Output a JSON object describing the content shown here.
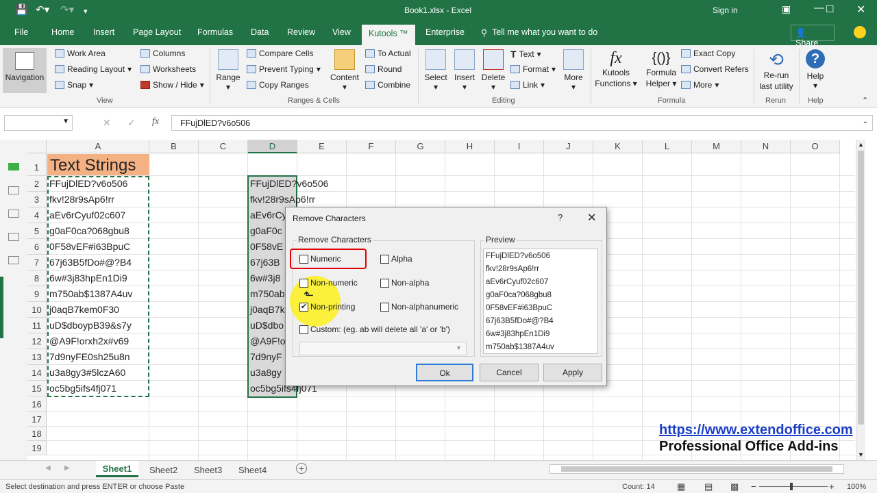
{
  "window": {
    "title": "Book1.xlsx  -  Excel",
    "sign_in": "Sign in"
  },
  "tabs": [
    "File",
    "Home",
    "Insert",
    "Page Layout",
    "Formulas",
    "Data",
    "Review",
    "View",
    "Kutools ™",
    "Enterprise"
  ],
  "tell_me": "Tell me what you want to do",
  "share": "Share",
  "ribbon": {
    "view_group": {
      "navigation": "Navigation",
      "work_area": "Work Area",
      "reading_layout": "Reading Layout",
      "snap": "Snap",
      "columns": "Columns",
      "worksheets": "Worksheets",
      "show_hide": "Show / Hide",
      "label": "View"
    },
    "ranges_group": {
      "range": "Range",
      "compare_cells": "Compare Cells",
      "prevent_typing": "Prevent Typing",
      "copy_ranges": "Copy Ranges",
      "content": "Content",
      "to_actual": "To Actual",
      "round": "Round",
      "combine": "Combine",
      "label": "Ranges & Cells"
    },
    "editing_group": {
      "select": "Select",
      "insert": "Insert",
      "delete": "Delete",
      "text": "Text",
      "format": "Format",
      "link": "Link",
      "more": "More",
      "label": "Editing"
    },
    "formula_group": {
      "kutools_functions": "Kutools\nFunctions",
      "formula_helper": "Formula\nHelper",
      "exact_copy": "Exact Copy",
      "convert_refers": "Convert Refers",
      "more": "More",
      "label": "Formula"
    },
    "rerun_group": {
      "rerun": "Re-run\nlast utility",
      "label": "Rerun"
    },
    "help_group": {
      "help": "Help",
      "label": "Help"
    }
  },
  "formula_bar": {
    "name_box": "",
    "content": "FFujDlED?v6o506",
    "fx": "fx"
  },
  "columns": [
    "A",
    "B",
    "C",
    "D",
    "E",
    "F",
    "G",
    "H",
    "I",
    "J",
    "K",
    "L",
    "M",
    "N",
    "O"
  ],
  "rows": [
    "1",
    "2",
    "3",
    "4",
    "5",
    "6",
    "7",
    "8",
    "9",
    "10",
    "11",
    "12",
    "13",
    "14",
    "15",
    "16",
    "17",
    "18",
    "19"
  ],
  "header_cell": "Text Strings",
  "col_a": [
    "FFujDlED?v6o506",
    "fkv!28r9sAp6!rr",
    "aEv6rCyuf02c607",
    "g0aF0ca?068gbu8",
    "0F58vEF#i63BpuC",
    "67j63B5fDo#@?B4",
    "6w#3j83hpEn1Di9",
    "m750ab$1387A4uv",
    "j0aqB7kem0F30",
    "uD$dboypB39&s7y",
    "@A9F!orxh2x#v69",
    "7d9nyFE0sh25u8n",
    "u3a8gy3#5lczA60",
    "oc5bg5ifs4fj071"
  ],
  "col_d": [
    "FFujDlED?v6o506",
    "fkv!28r9sAp6!rr",
    "aEv6rCy",
    "g0aF0c",
    "0F58vE",
    "67j63B",
    "6w#3j8",
    "m750ab",
    "j0aqB7k",
    "uD$dbo",
    "@A9F!o",
    "7d9nyF",
    "u3a8gy",
    "oc5bg5ifs4fj071"
  ],
  "dialog": {
    "title": "Remove Characters",
    "help": "?",
    "group_label": "Remove Characters",
    "numeric": "Numeric",
    "alpha": "Alpha",
    "non_numeric": "Non-numeric",
    "non_alpha": "Non-alpha",
    "non_printing": "Non-printing",
    "non_alphanumeric": "Non-alphanumeric",
    "custom": "Custom: (eg. ab will delete all 'a' or 'b')",
    "preview_label": "Preview",
    "preview": [
      "FFujDlED?v6o506",
      "fkv!28r9sAp6!rr",
      "aEv6rCyuf02c607",
      "g0aF0ca?068gbu8",
      "0F58vEF#i63BpuC",
      "67j63B5fDo#@?B4",
      "6w#3j83hpEn1Di9",
      "m750ab$1387A4uv"
    ],
    "ok": "Ok",
    "cancel": "Cancel",
    "apply": "Apply"
  },
  "watermark": {
    "url": "https://www.extendoffice.com",
    "tagline": "Professional Office Add-ins"
  },
  "sheets": [
    "Sheet1",
    "Sheet2",
    "Sheet3",
    "Sheet4"
  ],
  "status": {
    "message": "Select destination and press ENTER or choose Paste",
    "count": "Count: 14",
    "zoom": "100%"
  },
  "colors": {
    "excel_green": "#217346",
    "header_fill": "#f4b183",
    "highlight_red": "#e00000"
  }
}
